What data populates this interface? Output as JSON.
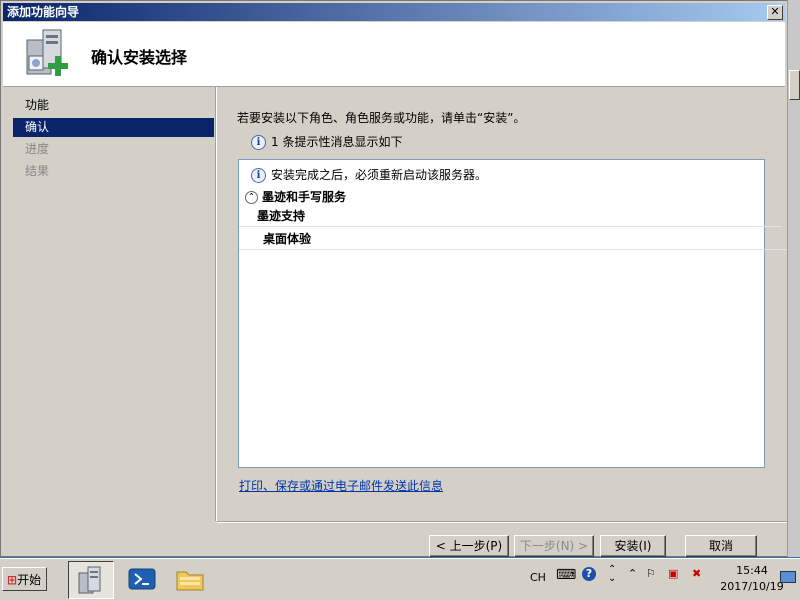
{
  "window": {
    "title": "添加功能向导",
    "close_glyph": "✕"
  },
  "header": {
    "title": "确认安装选择",
    "icon": "server-add-icon"
  },
  "nav": {
    "items": [
      {
        "label": "功能",
        "state": "done"
      },
      {
        "label": "确认",
        "state": "active"
      },
      {
        "label": "进度",
        "state": "disabled"
      },
      {
        "label": "结果",
        "state": "disabled"
      }
    ]
  },
  "content": {
    "instruction": "若要安装以下角色、角色服务或功能，请单击“安装”。",
    "info_message": "1 条提示性消息显示如下",
    "note": "安装完成之后，必须重新启动该服务器。",
    "group": "墨迹和手写服务",
    "features": [
      "墨迹支持",
      "桌面体验"
    ],
    "link": "打印、保存或通过电子邮件发送此信息"
  },
  "buttons": {
    "prev": "< 上一步(P)",
    "next": "下一步(N) >",
    "install": "安装(I)",
    "cancel": "取消"
  },
  "taskbar": {
    "start": "开始",
    "apps": [
      "server-manager-icon",
      "powershell-icon",
      "explorer-icon"
    ],
    "lang": "CH",
    "time": "15:44",
    "date": "2017/10/19"
  }
}
